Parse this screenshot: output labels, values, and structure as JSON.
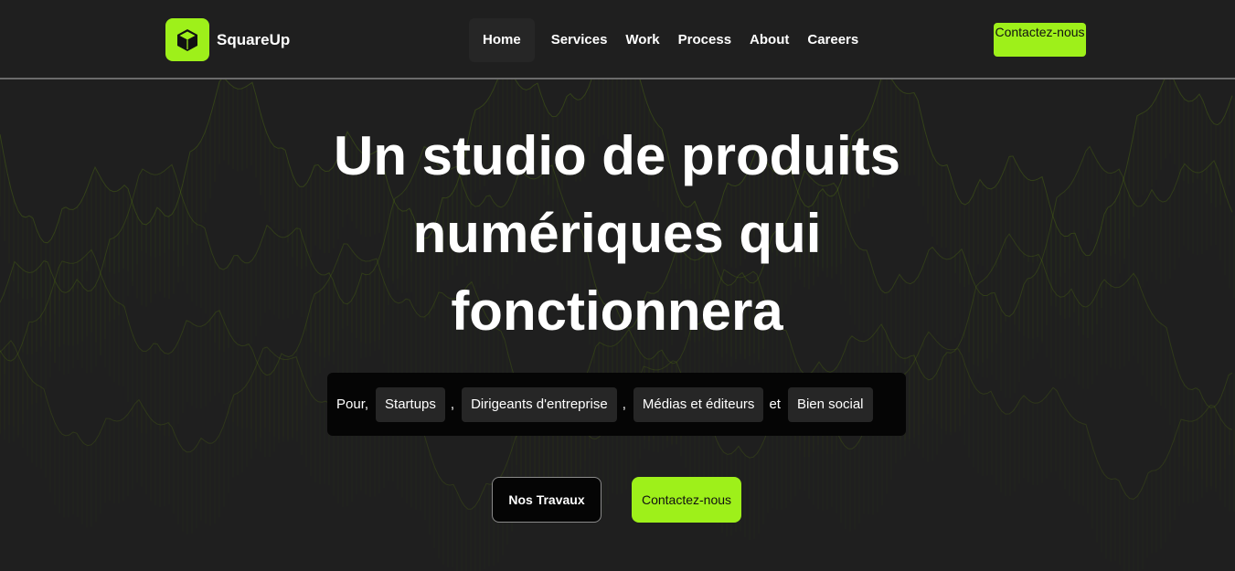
{
  "header": {
    "brand": "SquareUp",
    "logo_icon": "cube-icon",
    "nav": [
      {
        "label": "Home",
        "active": true
      },
      {
        "label": "Services",
        "active": false
      },
      {
        "label": "Work",
        "active": false
      },
      {
        "label": "Process",
        "active": false
      },
      {
        "label": "About",
        "active": false
      },
      {
        "label": "Careers",
        "active": false
      }
    ],
    "cta_label": "Contactez-nous"
  },
  "hero": {
    "title": "Un studio de produits numériques qui fonctionnera",
    "audience_intro": "Pour,",
    "audiences": [
      "Startups",
      "Dirigeants d'entreprise",
      "Médias et éditeurs",
      "Bien social"
    ],
    "separators": [
      ",",
      ",",
      "et"
    ],
    "secondary_button": "Nos Travaux",
    "primary_button": "Contactez-nous"
  },
  "colors": {
    "accent": "#9ef01a",
    "background": "#1f1f1f",
    "panel": "#050505",
    "pill": "#262626"
  }
}
